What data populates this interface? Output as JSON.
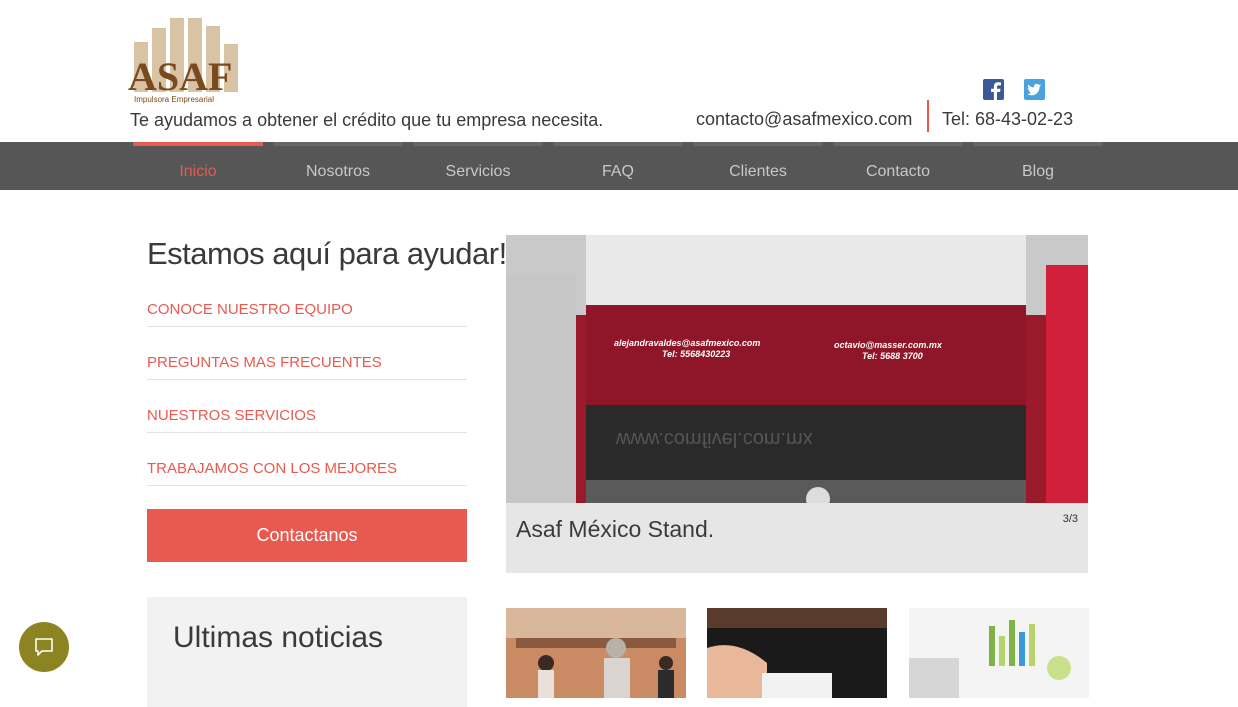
{
  "header": {
    "logo_text": "ASAF",
    "logo_subtext": "Impulsora Empresarial",
    "tagline": "Te ayudamos a obtener el crédito que tu empresa necesita.",
    "email": "contacto@asafmexico.com",
    "phone": "Tel: 68-43-02-23",
    "social": [
      "facebook-icon",
      "twitter-icon"
    ]
  },
  "nav": {
    "items": [
      {
        "label": "Inicio",
        "active": true
      },
      {
        "label": "Nosotros"
      },
      {
        "label": "Servicios"
      },
      {
        "label": "FAQ"
      },
      {
        "label": "Clientes"
      },
      {
        "label": "Contacto"
      },
      {
        "label": "Blog"
      }
    ]
  },
  "help": {
    "title": "Estamos aquí para ayudar!",
    "links": [
      "CONOCE NUESTRO EQUIPO",
      "PREGUNTAS MAS FRECUENTES",
      "NUESTROS SERVICIOS",
      "TRABAJAMOS CON LOS MEJORES"
    ],
    "cta_label": "Contactanos"
  },
  "slider": {
    "caption": "Asaf México Stand.",
    "counter": "3/3",
    "image": {
      "email_left": "alejandravaldes@asafmexico.com",
      "tel_left": "Tel: 5568430223",
      "email_right": "octavio@masser.com.mx",
      "tel_right": "Tel: 5688 3700",
      "reflection": "www.comfivel.com.mx"
    }
  },
  "news": {
    "title": "Ultimas noticias"
  },
  "colors": {
    "accent": "#e85a4f",
    "nav_bg": "#565656",
    "chat": "#8c8420"
  }
}
